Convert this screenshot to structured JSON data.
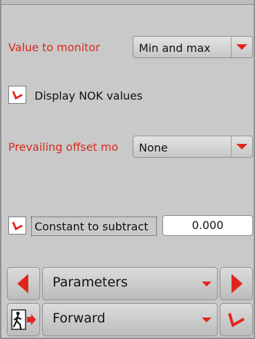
{
  "fields": {
    "value_to_monitor": {
      "label": "Value to monitor",
      "selected": "Min and max"
    },
    "display_nok": {
      "label": "Display NOK values",
      "checked": true
    },
    "prevailing_offset": {
      "label": "Prevailing offset mo",
      "selected": "None"
    },
    "constant_to_subtract": {
      "label": "Constant to subtract",
      "checked": true,
      "value": "0.000"
    }
  },
  "nav": {
    "section_label": "Parameters",
    "direction_label": "Forward"
  },
  "icons": {
    "prev": "arrow-left-icon",
    "next": "arrow-right-icon",
    "exit": "exit-person-icon",
    "confirm": "checkmark-icon",
    "dropdown": "chevron-down-icon"
  },
  "colors": {
    "accent_red": "#e0261c",
    "label_red": "#d62a1e",
    "background": "#c9c9c9"
  }
}
